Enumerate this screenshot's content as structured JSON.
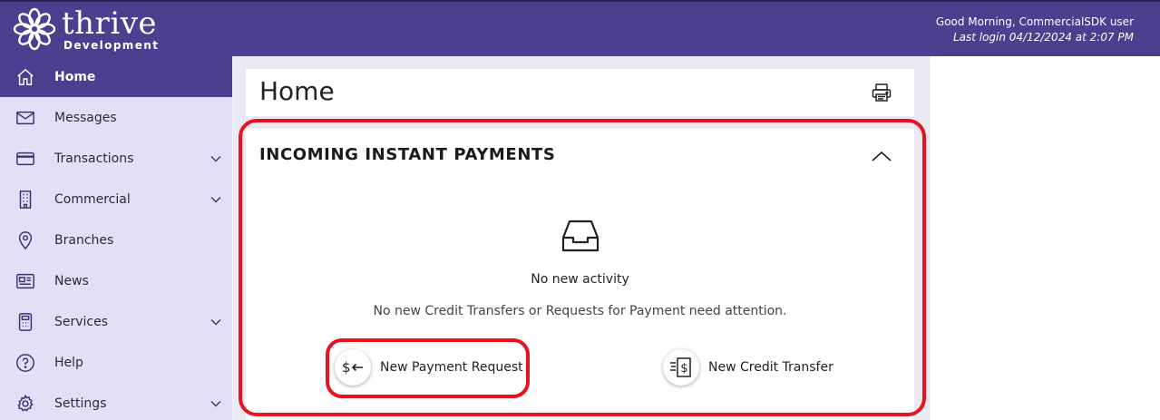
{
  "header": {
    "brand": "thrive",
    "brand_sub": "Development",
    "greeting": "Good Morning, CommercialSDK user",
    "last_login": "Last login 04/12/2024 at 2:07 PM",
    "bg_color": "#4b3f8f"
  },
  "sidebar": {
    "items": [
      {
        "label": "Home",
        "icon": "home-icon",
        "active": true,
        "expandable": false
      },
      {
        "label": "Messages",
        "icon": "envelope-icon",
        "active": false,
        "expandable": false
      },
      {
        "label": "Transactions",
        "icon": "credit-card-icon",
        "active": false,
        "expandable": true
      },
      {
        "label": "Commercial",
        "icon": "building-icon",
        "active": false,
        "expandable": true
      },
      {
        "label": "Branches",
        "icon": "map-pin-icon",
        "active": false,
        "expandable": false
      },
      {
        "label": "News",
        "icon": "newspaper-icon",
        "active": false,
        "expandable": false
      },
      {
        "label": "Services",
        "icon": "calculator-icon",
        "active": false,
        "expandable": true
      },
      {
        "label": "Help",
        "icon": "question-circle-icon",
        "active": false,
        "expandable": false
      },
      {
        "label": "Settings",
        "icon": "gear-icon",
        "active": false,
        "expandable": true
      }
    ]
  },
  "page": {
    "title": "Home",
    "print_icon": "printer-icon"
  },
  "incoming_payments": {
    "title": "INCOMING INSTANT PAYMENTS",
    "collapse_icon": "chevron-up-icon",
    "empty_icon": "inbox-tray-icon",
    "empty_title": "No new activity",
    "empty_message": "No new Credit Transfers or Requests for Payment need attention.",
    "actions": [
      {
        "label": "New Payment Request",
        "icon": "dollar-arrow-left-icon"
      },
      {
        "label": "New Credit Transfer",
        "icon": "receipt-dollar-icon"
      }
    ]
  },
  "highlight_color": "#e8131f"
}
